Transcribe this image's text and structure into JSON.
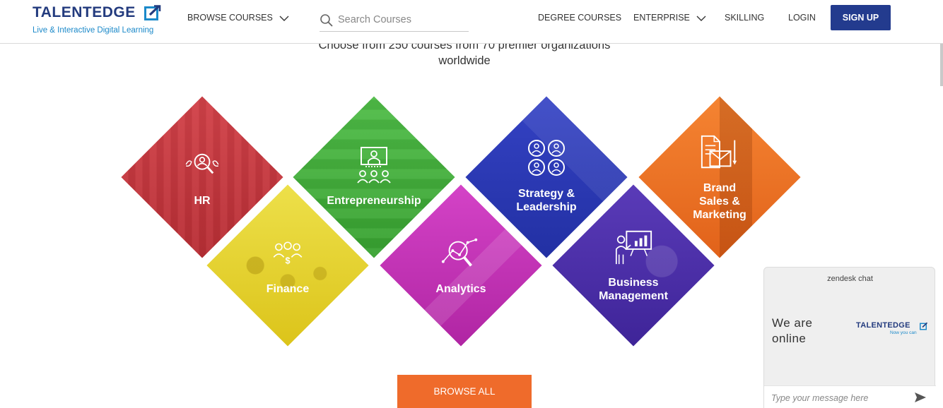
{
  "header": {
    "logo_text": "TALENTEDGE",
    "logo_tagline": "Live & Interactive Digital Learning",
    "browse_courses": "BROWSE COURSES",
    "search_placeholder": "Search Courses",
    "degree_courses": "DEGREE COURSES",
    "enterprise": "ENTERPRISE",
    "skilling": "SKILLING",
    "login": "LOGIN",
    "signup": "SIGN UP"
  },
  "intro": {
    "line1": "Choose from 250 courses from 70 premier organizations",
    "line2": "worldwide"
  },
  "categories": [
    {
      "label1": "HR",
      "label2": "",
      "label3": "",
      "color": "#c9363c",
      "icon": "magnifier-people-icon"
    },
    {
      "label1": "Finance",
      "label2": "",
      "label3": "",
      "color": "#e8d21e",
      "icon": "people-dollar-icon"
    },
    {
      "label1": "Entrepreneurship",
      "label2": "",
      "label3": "",
      "color": "#3fae3a",
      "icon": "presentation-people-icon"
    },
    {
      "label1": "Analytics",
      "label2": "",
      "label3": "",
      "color": "#c52fb5",
      "icon": "chart-magnifier-icon"
    },
    {
      "label1": "Strategy &",
      "label2": "Leadership",
      "label3": "",
      "color": "#2a37b2",
      "icon": "team-group-icon"
    },
    {
      "label1": "Business",
      "label2": "Management",
      "label3": "",
      "color": "#4e2fa8",
      "icon": "presenter-board-icon"
    },
    {
      "label1": "Brand",
      "label2": "Sales &",
      "label3": "Marketing",
      "color": "#ef7322",
      "icon": "documents-mail-icon"
    }
  ],
  "browse_all": "BROWSE ALL",
  "chat": {
    "title": "zendesk chat",
    "status_line1": "We are",
    "status_line2": "online",
    "logo_text": "TALENTEDGE",
    "logo_tagline": "Now you can",
    "input_placeholder": "Type your message here"
  },
  "colors": {
    "brand_navy": "#233b8e",
    "brand_blue": "#1b89c9",
    "browse_all_orange": "#ef6b2b"
  }
}
